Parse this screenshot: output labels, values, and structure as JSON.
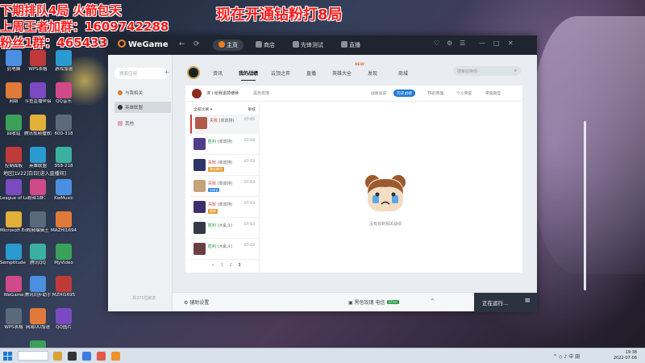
{
  "overlay": {
    "line1": "下期排队4局   火箭包天",
    "line2": "上周王者加群：1609742288",
    "line3": "粉丝1群：465433607",
    "center": "现在开通钻粉打8局"
  },
  "desktop_icons": {
    "col1": [
      "此电脑",
      "网络",
      "回收站",
      "控制面板",
      "League of Legends",
      "Microsoft Edge",
      "Semptitude ProX",
      "WeGame",
      "WPS表格"
    ],
    "col2": [
      "WPS表格",
      "斗鱼直播伴侣",
      "腾讯视频播放器",
      "英雄联盟",
      "粉丝1群：",
      "视频编辑王",
      "腾讯QQ",
      "腾讯同步助手",
      "网易UU加速",
      "微信"
    ],
    "col3": [
      "游戏加速",
      "QQ音乐",
      "600-318",
      "958-218",
      "KwMusic",
      "MAZHI1694",
      "MyVideo",
      "MZHI1695",
      "QQ图片"
    ],
    "note": "地区[LV22]白日[进入直播间]"
  },
  "window": {
    "title": "WeGame",
    "back": "←",
    "refresh": "⟳",
    "top_nav": [
      {
        "label": "主页",
        "active": true
      },
      {
        "label": "商店",
        "active": false
      },
      {
        "label": "先锋测试",
        "active": false
      },
      {
        "label": "直播",
        "active": false
      }
    ],
    "controls": [
      "♡",
      "⚙",
      "☰",
      "—",
      "□",
      "✕"
    ]
  },
  "sidebar": {
    "search_placeholder": "搜索应用",
    "add": "+",
    "items": [
      {
        "label": "与我相关",
        "icon": "orange-circle-icon",
        "active": false
      },
      {
        "label": "英雄联盟",
        "icon": "lol-icon",
        "active": true
      },
      {
        "label": "其他",
        "icon": "pink-square-icon",
        "active": false
      }
    ],
    "online": "共271位好友"
  },
  "main_tabs": [
    {
      "label": "资讯",
      "active": false
    },
    {
      "label": "我的战绩",
      "active": true
    },
    {
      "label": "云顶之弈",
      "active": false
    },
    {
      "label": "直播",
      "active": false
    },
    {
      "label": "英雄大全",
      "active": false
    },
    {
      "label": "发现",
      "active": false
    },
    {
      "label": "商城",
      "active": false
    }
  ],
  "new_tag": "NEW",
  "main_search_placeholder": "搜索召唤师",
  "panel": {
    "player": "沫丨给我退掉继续",
    "region": "黑色玫瑰",
    "tabs": [
      {
        "label": "战绩总览",
        "active": false
      },
      {
        "label": "历史战绩",
        "active": true
      },
      {
        "label": "TA的英雄",
        "active": false
      },
      {
        "label": "个人荣誉",
        "active": false
      },
      {
        "label": "荣誉殿堂",
        "active": false
      }
    ],
    "filter": "全部比赛",
    "sort": "审核",
    "matches": [
      {
        "result": "失败",
        "mode": "(单双排)",
        "date": "07-05",
        "tag": "",
        "tag_type": "gray",
        "color": "#b05a4a"
      },
      {
        "result": "胜利",
        "mode": "(单双排)",
        "date": "07-04",
        "tag": "",
        "tag_type": "gray",
        "color": "#4b3f8a"
      },
      {
        "result": "失败",
        "mode": "(单双排)",
        "date": "07-03",
        "tag": "最佳输出",
        "tag_type": "orange",
        "color": "#2c3566"
      },
      {
        "result": "失败",
        "mode": "(单双排)",
        "date": "07-03",
        "tag": "carry",
        "tag_type": "blue",
        "color": "#c7a17a"
      },
      {
        "result": "失败",
        "mode": "(单双排)",
        "date": "07-03",
        "tag": "超神",
        "tag_type": "orange",
        "color": "#3b2f6a"
      },
      {
        "result": "胜利",
        "mode": "(大乱斗)",
        "date": "07-03",
        "tag": "",
        "tag_type": "gray",
        "color": "#343a42"
      },
      {
        "result": "胜利",
        "mode": "(大乱斗)",
        "date": "07-03",
        "tag": "",
        "tag_type": "gray",
        "color": "#6a3f42"
      }
    ],
    "pager": {
      "prev": "<",
      "page1": "1",
      "page2": "2",
      "page3": "3"
    },
    "empty_text": "没有找到相关战绩"
  },
  "bottombar": {
    "settings": "辅助设置",
    "region": "黑色玫瑰 电信",
    "badge": "37ms",
    "arrow": "^",
    "running": "正在运行...",
    "menu": "≡"
  },
  "taskbar": {
    "time": "19:38",
    "date": "2022-07-06",
    "tray": "^  ◇  ♪  中  田"
  }
}
